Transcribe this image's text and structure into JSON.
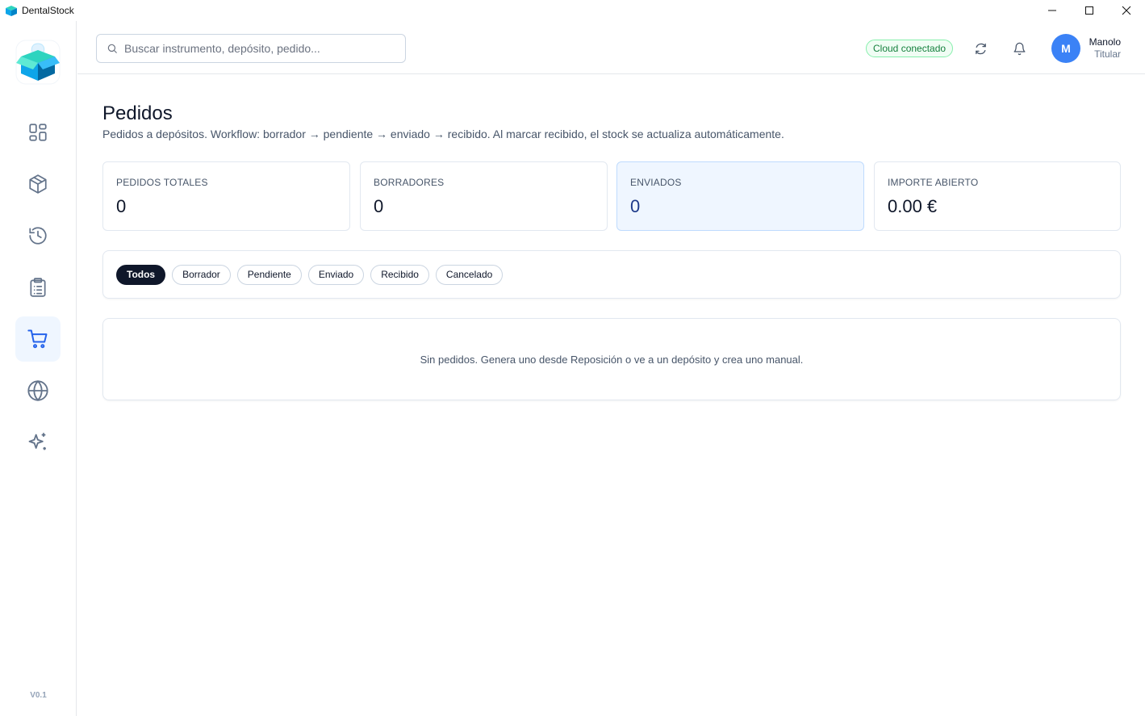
{
  "window": {
    "title": "DentalStock",
    "controls": [
      "minimize",
      "maximize",
      "close"
    ]
  },
  "sidebar": {
    "logo_icon": "dental-box-logo",
    "items": [
      {
        "icon": "dashboard-grid-icon",
        "active": false
      },
      {
        "icon": "cube-box-icon",
        "active": false
      },
      {
        "icon": "history-clock-icon",
        "active": false
      },
      {
        "icon": "clipboard-list-icon",
        "active": false
      },
      {
        "icon": "shopping-cart-icon",
        "active": true
      },
      {
        "icon": "globe-icon",
        "active": false
      },
      {
        "icon": "sparkles-icon",
        "active": false
      }
    ],
    "version": "V0.1"
  },
  "header": {
    "search_placeholder": "Buscar instrumento, depósito, pedido...",
    "search_value": "",
    "cloud_status": "Cloud conectado",
    "user": {
      "initial": "M",
      "name": "Manolo",
      "role": "Titular"
    }
  },
  "main": {
    "title": "Pedidos",
    "subtitle": "Pedidos a depósitos. Workflow: borrador → pendiente → enviado → recibido. Al marcar recibido, el stock se actualiza automáticamente.",
    "stats": [
      {
        "label": "PEDIDOS TOTALES",
        "value": "0",
        "highlight": false
      },
      {
        "label": "BORRADORES",
        "value": "0",
        "highlight": false
      },
      {
        "label": "ENVIADOS",
        "value": "0",
        "highlight": true
      },
      {
        "label": "IMPORTE ABIERTO",
        "value": "0.00 €",
        "highlight": false
      }
    ],
    "filters": [
      "Todos",
      "Borrador",
      "Pendiente",
      "Enviado",
      "Recibido",
      "Cancelado"
    ],
    "active_filter": "Todos",
    "empty_message": "Sin pedidos. Genera uno desde Reposición o ve a un depósito y crea uno manual."
  },
  "colors": {
    "accent": "#2563eb",
    "active_nav_bg": "#eff6ff",
    "cloud_green": "#15803d",
    "avatar_blue": "#3b82f6",
    "chip_active": "#0f172a"
  }
}
